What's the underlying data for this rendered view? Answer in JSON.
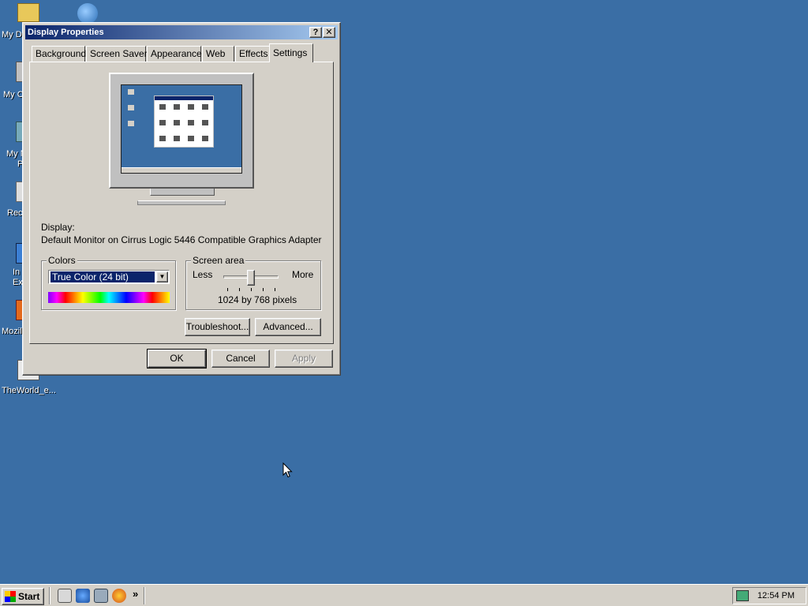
{
  "desktop": {
    "icons": [
      {
        "label": "My Do"
      },
      {
        "label": "My C"
      },
      {
        "label": "My N"
      },
      {
        "label": "P"
      },
      {
        "label": "Rec"
      },
      {
        "label": "In"
      },
      {
        "label": "Ex"
      },
      {
        "label": "Mozill"
      },
      {
        "label": "TheWorld_e..."
      }
    ]
  },
  "dialog": {
    "title": "Display Properties",
    "help_button": "?",
    "close_button": "✕",
    "tabs": [
      {
        "label": "Background"
      },
      {
        "label": "Screen Saver"
      },
      {
        "label": "Appearance"
      },
      {
        "label": "Web"
      },
      {
        "label": "Effects"
      },
      {
        "label": "Settings"
      }
    ],
    "active_tab": "Settings",
    "display_label": "Display:",
    "display_value": "Default Monitor on Cirrus Logic 5446 Compatible Graphics Adapter",
    "colors": {
      "group_title": "Colors",
      "selected": "True Color (24 bit)"
    },
    "screen_area": {
      "group_title": "Screen area",
      "less_label": "Less",
      "more_label": "More",
      "resolution_text": "1024 by 768 pixels",
      "slider_position": 0.5
    },
    "buttons": {
      "troubleshoot": "Troubleshoot...",
      "advanced": "Advanced...",
      "ok": "OK",
      "cancel": "Cancel",
      "apply": "Apply"
    }
  },
  "taskbar": {
    "start_label": "Start",
    "more_glyph": "»",
    "clock": "12:54 PM"
  }
}
